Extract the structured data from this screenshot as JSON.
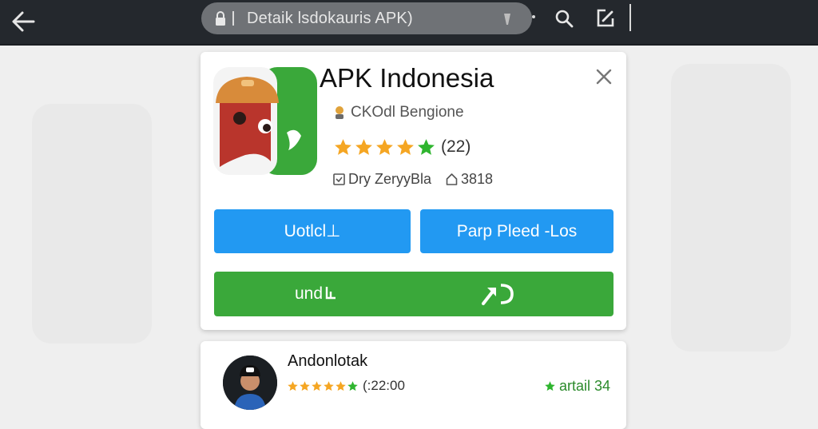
{
  "browser": {
    "address_text": "Detaik lsdokauris APK)",
    "icons": {
      "back": "back-arrow-icon",
      "lock": "lock-icon",
      "mic": "mic-icon",
      "search": "search-icon",
      "edit": "edit-icon"
    }
  },
  "app": {
    "title": "APK Indonesia",
    "developer": "CKOdl  Bengione",
    "rating": {
      "stars_filled": 5,
      "count_text": "(22)"
    },
    "meta": [
      {
        "icon": "calendar-icon",
        "text": "Dry ZeryyBla"
      },
      {
        "icon": "home-icon",
        "text": "3818"
      }
    ],
    "buttons": {
      "left_label": "Uotlcl⊥",
      "right_label": "Parp Pleed -Los",
      "green_left_label": "und",
      "green_right_icon": "share-arrow-icon"
    },
    "colors": {
      "blue_button": "#2299f2",
      "green_button": "#3aa83a",
      "star_gold": "#f5a623",
      "star_green": "#2fb52f"
    }
  },
  "review": {
    "name": "Andonlotak",
    "stars_filled": 5,
    "meta_text": "(:22:00",
    "badge_text": "artail 34"
  }
}
